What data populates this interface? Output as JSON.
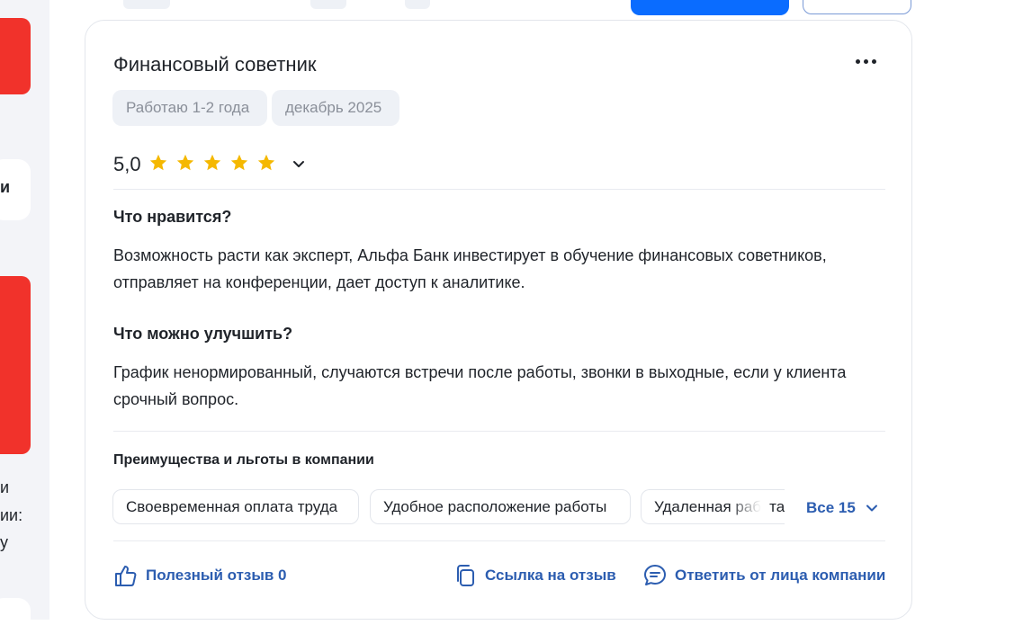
{
  "review": {
    "title": "Финансовый советник",
    "tags": [
      "Работаю 1-2 года",
      "декабрь 2025"
    ],
    "rating": "5,0",
    "stars": 5,
    "likes_heading": "Что нравится?",
    "likes_text": "Возможность расти как эксперт, Альфа Банк инвестирует в обучение финансовых советников, отправляет на конференции, дает доступ к аналитике.",
    "improve_heading": "Что можно улучшить?",
    "improve_text": "График ненормированный, случаются встречи после работы, звонки в выходные, если у клиента срочный вопрос.",
    "benefits_heading": "Преимущества и льготы в компании",
    "benefits": [
      "Своевременная оплата труда",
      "Удобное расположение работы",
      "Удаленная работа"
    ],
    "benefits_all": "Все 15",
    "actions": {
      "helpful": "Полезный отзыв 0",
      "link": "Ссылка на отзыв",
      "reply": "Ответить от лица компании"
    }
  },
  "left_fragments": {
    "line_a": "и",
    "line_b": "ии:",
    "line_c": "у",
    "line_d": "и"
  },
  "colors": {
    "accent": "#0a6cff",
    "link": "#2c5db0",
    "star": "#f5b800",
    "brand_red": "#f1322b"
  }
}
